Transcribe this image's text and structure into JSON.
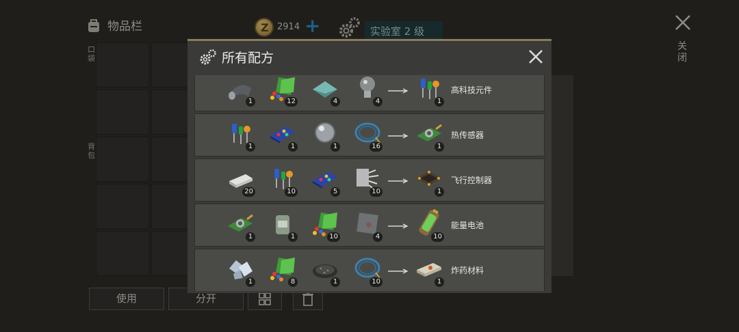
{
  "background": {
    "inventory_title": "物品栏",
    "pocket_label": "口袋",
    "backpack_label": "背包",
    "coins": "2914",
    "coin_glyph": "Z",
    "add_label": "+",
    "lab_label": "实验室 2 级",
    "close_label": "关闭",
    "use_button": "使用",
    "split_button": "分开"
  },
  "modal": {
    "title": "所有配方"
  },
  "recipes": [
    {
      "name": "高科技元件",
      "ingredients": [
        {
          "icon": "metal-sheet-icon",
          "count": "1"
        },
        {
          "icon": "electronic-parts-icon",
          "count": "12"
        },
        {
          "icon": "glass-plate-icon",
          "count": "4"
        },
        {
          "icon": "light-bulb-icon",
          "count": "4"
        }
      ],
      "output": {
        "icon": "electronic-components-icon",
        "count": "1"
      }
    },
    {
      "name": "热传感器",
      "ingredients": [
        {
          "icon": "electronic-components-icon",
          "count": "1"
        },
        {
          "icon": "circuit-board-icon",
          "count": "1"
        },
        {
          "icon": "lens-icon",
          "count": "1"
        },
        {
          "icon": "wire-coil-icon",
          "count": "16"
        }
      ],
      "output": {
        "icon": "thermal-sensor-icon",
        "count": "1"
      }
    },
    {
      "name": "飞行控制器",
      "ingredients": [
        {
          "icon": "metal-ingot-icon",
          "count": "20"
        },
        {
          "icon": "electronic-components-icon",
          "count": "10"
        },
        {
          "icon": "circuit-board-icon",
          "count": "5"
        },
        {
          "icon": "metal-scrap-icon",
          "count": "10"
        }
      ],
      "output": {
        "icon": "flight-controller-icon",
        "count": "1"
      }
    },
    {
      "name": "能量电池",
      "ingredients": [
        {
          "icon": "thermal-sensor-icon",
          "count": "1"
        },
        {
          "icon": "chemical-bottle-icon",
          "count": "1"
        },
        {
          "icon": "electronic-parts-icon",
          "count": "10"
        },
        {
          "icon": "metal-plate-icon",
          "count": "4"
        }
      ],
      "output": {
        "icon": "energy-cell-icon",
        "count": "10"
      }
    },
    {
      "name": "炸药材料",
      "ingredients": [
        {
          "icon": "crystal-icon",
          "count": "1"
        },
        {
          "icon": "electronic-parts-icon",
          "count": "8"
        },
        {
          "icon": "gunpowder-icon",
          "count": "1"
        },
        {
          "icon": "wire-coil-icon",
          "count": "10"
        }
      ],
      "output": {
        "icon": "explosive-material-icon",
        "count": "1"
      }
    }
  ]
}
